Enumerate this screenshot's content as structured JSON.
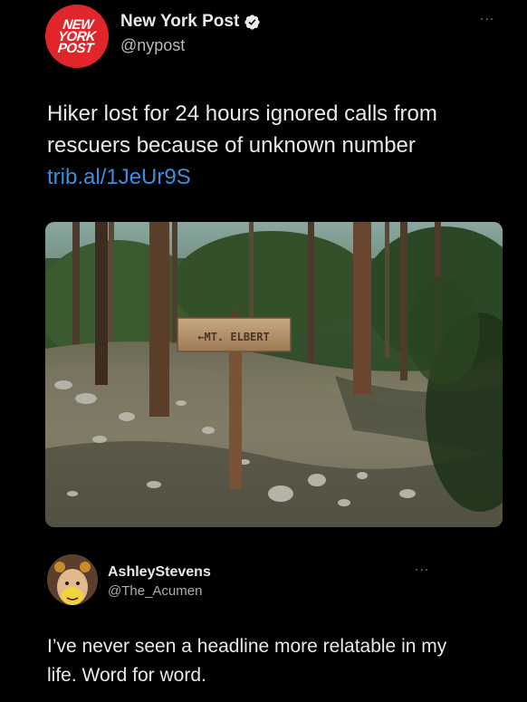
{
  "tweet": {
    "author": {
      "display_name": "New York Post",
      "handle": "@nypost",
      "avatar_logo_lines": [
        "NEW",
        "YORK",
        "POST"
      ],
      "verified_icon": "verified-badge-icon",
      "avatar_color": "#e0252b"
    },
    "more_label": "···",
    "text": "Hiker lost for 24 hours ignored calls from rescuers because of unknown number ",
    "link": "trib.al/1JeUr9S",
    "link_color": "#3a8fe0",
    "media": {
      "sign_text": "←MT. ELBERT"
    }
  },
  "reply": {
    "display_name": "AshleyStevens",
    "handle": "@The_Acumen",
    "more_label": "···",
    "text": "I’ve never seen a headline more relatable in my life. Word for word."
  }
}
